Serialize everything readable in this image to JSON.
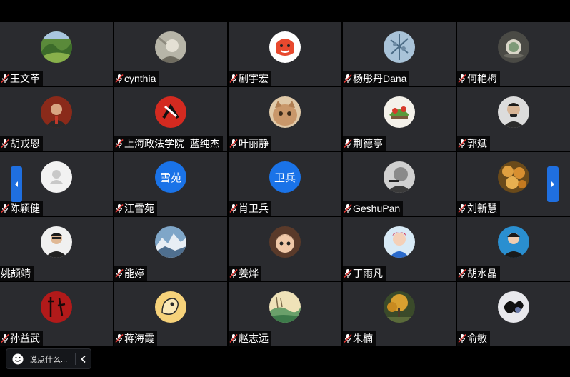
{
  "participants": [
    {
      "name": "王文革"
    },
    {
      "name": "cynthia"
    },
    {
      "name": "剧宇宏"
    },
    {
      "name": "杨彤丹Dana"
    },
    {
      "name": "何艳梅"
    },
    {
      "name": "胡戎恩"
    },
    {
      "name": "上海政法学院_蓝纯杰"
    },
    {
      "name": "叶丽静"
    },
    {
      "name": "荆德亭"
    },
    {
      "name": "郭斌"
    },
    {
      "name": "陈颖健"
    },
    {
      "name": "汪雪苑",
      "avatar_text": "雪苑",
      "avatar_color": "#1a73e8"
    },
    {
      "name": "肖卫兵",
      "avatar_text": "卫兵",
      "avatar_color": "#1a73e8"
    },
    {
      "name": "GeshuPan"
    },
    {
      "name": "刘新慧"
    },
    {
      "name": "姚颉靖"
    },
    {
      "name": "能婷"
    },
    {
      "name": "姜烨"
    },
    {
      "name": "丁雨凡"
    },
    {
      "name": "胡水晶"
    },
    {
      "name": "孙益武"
    },
    {
      "name": "蒋海霞"
    },
    {
      "name": "赵志远"
    },
    {
      "name": "朱楠"
    },
    {
      "name": "俞敏"
    }
  ],
  "chat": {
    "placeholder": "说点什么..."
  },
  "icons": {
    "mic_muted": "mic-muted-icon",
    "prev": "chevron-left-icon",
    "next": "chevron-right-icon",
    "emoji": "smiley-icon",
    "collapse": "chevron-left-icon"
  },
  "colors": {
    "accent": "#1f6fe0",
    "tile_bg": "#2a2b2f"
  }
}
